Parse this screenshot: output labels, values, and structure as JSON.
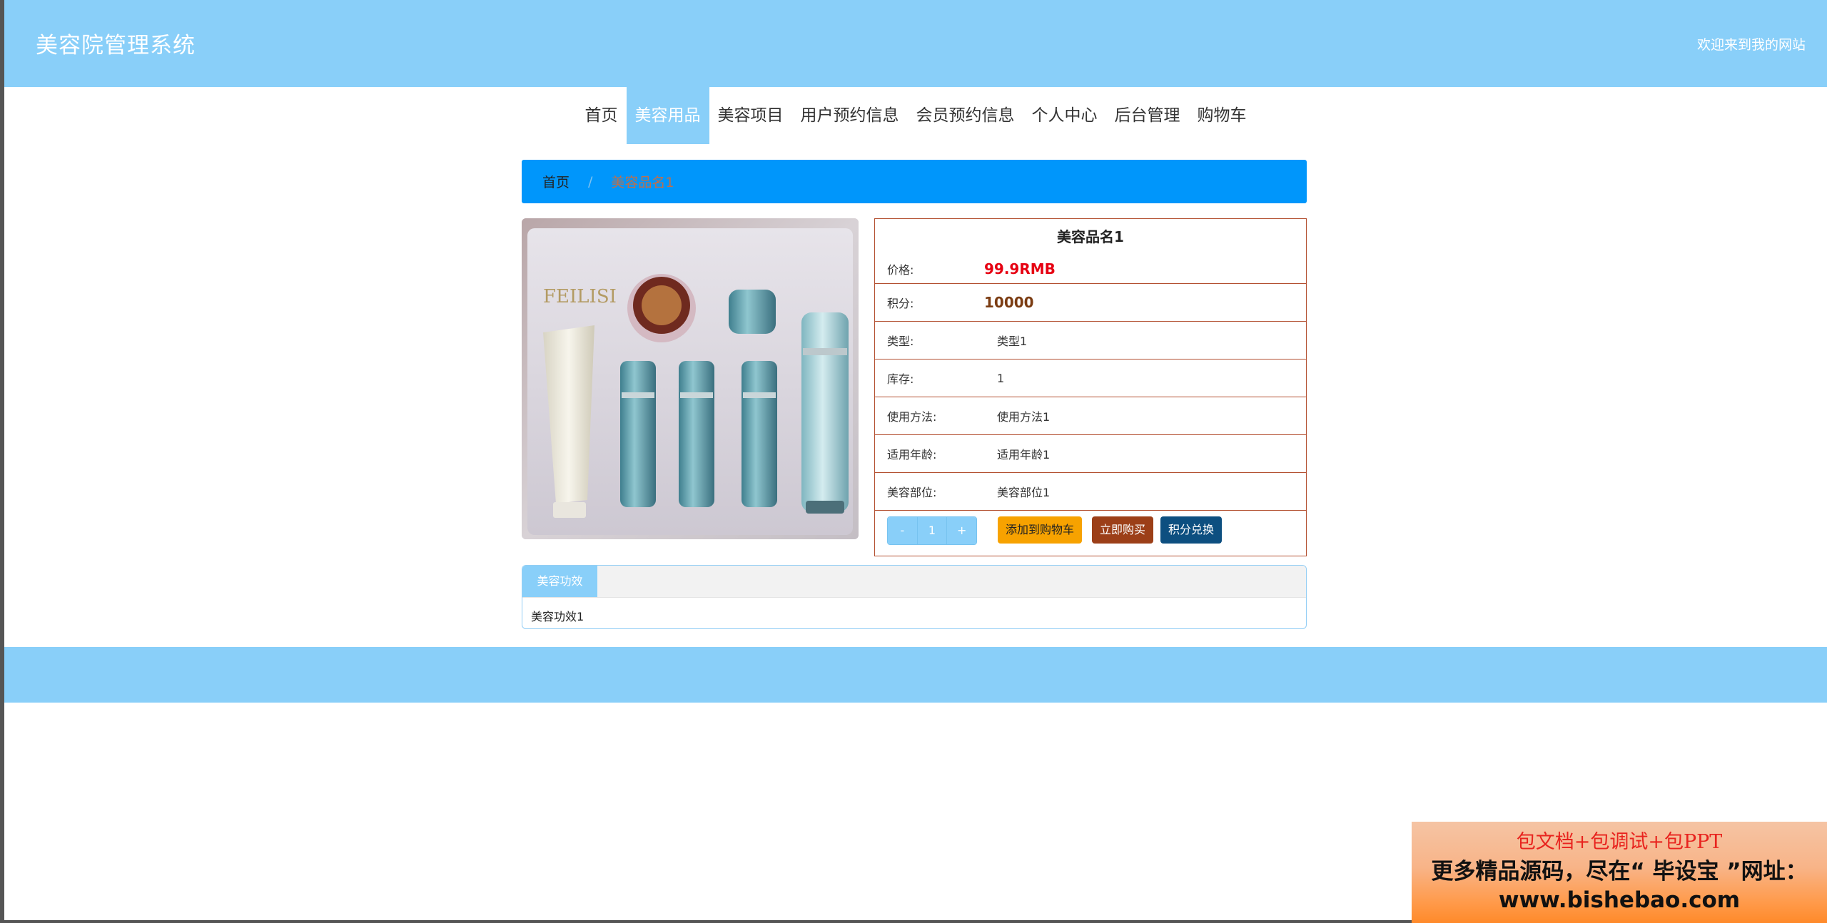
{
  "header": {
    "site_title": "美容院管理系统",
    "welcome": "欢迎来到我的网站"
  },
  "nav": {
    "items": [
      {
        "label": "首页",
        "active": false
      },
      {
        "label": "美容用品",
        "active": true
      },
      {
        "label": "美容项目",
        "active": false
      },
      {
        "label": "用户预约信息",
        "active": false
      },
      {
        "label": "会员预约信息",
        "active": false
      },
      {
        "label": "个人中心",
        "active": false
      },
      {
        "label": "后台管理",
        "active": false
      },
      {
        "label": "购物车",
        "active": false
      }
    ]
  },
  "breadcrumb": {
    "home": "首页",
    "separator": "/",
    "current": "美容品名1"
  },
  "product": {
    "name": "美容品名1",
    "image_brand_text": "FEILISI",
    "price_label": "价格:",
    "price_value": "99.9RMB",
    "points_label": "积分:",
    "points_value": "10000",
    "type_label": "类型:",
    "type_value": "类型1",
    "stock_label": "库存:",
    "stock_value": "1",
    "usage_label": "使用方法:",
    "usage_value": "使用方法1",
    "age_label": "适用年龄:",
    "age_value": "适用年龄1",
    "area_label": "美容部位:",
    "area_value": "美容部位1"
  },
  "actions": {
    "minus": "-",
    "quantity": "1",
    "plus": "+",
    "add_to_cart": "添加到购物车",
    "buy_now": "立即购买",
    "points_exchange": "积分兑换"
  },
  "tabs": {
    "tab_label": "美容功效",
    "content": "美容功效1"
  },
  "ad": {
    "line1": "包文档+包调试+包PPT",
    "line2": "更多精品源码，尽在“ 毕设宝 ”网址：",
    "line3": "www.bishebao.com"
  },
  "colors": {
    "primary": "#89cff9",
    "breadcrumb": "#0096fb",
    "price": "#e60012",
    "border": "#b34f30",
    "cart_button": "#f7a200",
    "buy_button": "#9c3f18",
    "exchange_button": "#0d4f80"
  }
}
